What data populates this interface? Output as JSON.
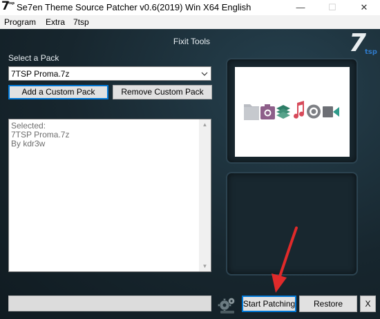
{
  "window": {
    "title": "Se7en Theme Source Patcher v0.6(2019) Win X64 English",
    "icon_text": "7",
    "icon_subtext": "tsp",
    "minimize_glyph": "—",
    "maximize_glyph": "☐",
    "close_glyph": "✕"
  },
  "menu": {
    "items": [
      "Program",
      "Extra",
      "7tsp"
    ]
  },
  "main": {
    "heading": "Fixit Tools",
    "logo_text": "7",
    "logo_subtext": "tsp",
    "select_pack_label": "Select a Pack",
    "selected_pack": "7TSP Proma.7z",
    "add_button": "Add a Custom Pack",
    "remove_button": "Remove Custom Pack",
    "info_lines": [
      "Selected:",
      "7TSP Proma.7z",
      "By kdr3w"
    ],
    "start_button": "Start Patching",
    "restore_button": "Restore",
    "close_button": "X"
  },
  "preview_icons": [
    "folder-icon",
    "camera-icon",
    "layers-icon",
    "music-note-icon",
    "disc-icon",
    "video-camera-icon"
  ],
  "colors": {
    "background": "#17262e",
    "panel": "#18272f",
    "accent_blue": "#0078d7",
    "folder_gray": "#b9bcc2",
    "camera_purple": "#8e5f8a",
    "layers_green": "#3f8f77",
    "music_red": "#d74a5a",
    "disc_gray": "#7d7f84",
    "video_teal": "#2f9a8a"
  }
}
